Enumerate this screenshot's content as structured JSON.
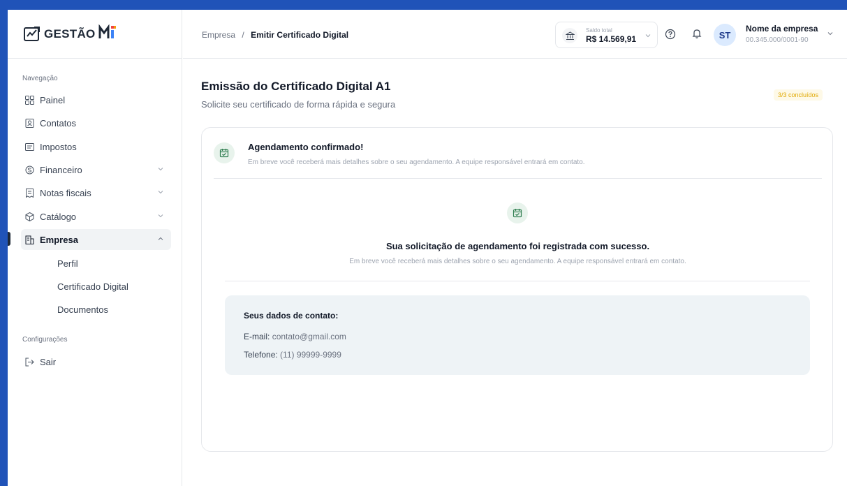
{
  "app": {
    "logo_text": "GESTÃO",
    "logo_mei": "MEI"
  },
  "sidebar": {
    "section_nav": "Navegação",
    "items": [
      {
        "label": "Painel",
        "icon": "grid-icon"
      },
      {
        "label": "Contatos",
        "icon": "contact-card-icon"
      },
      {
        "label": "Impostos",
        "icon": "tax-doc-icon"
      },
      {
        "label": "Financeiro",
        "icon": "money-icon"
      },
      {
        "label": "Notas fiscais",
        "icon": "receipt-icon"
      },
      {
        "label": "Catálogo",
        "icon": "box-icon"
      },
      {
        "label": "Empresa",
        "icon": "building-icon"
      }
    ],
    "empresa_sub": [
      "Perfil",
      "Certificado Digital",
      "Documentos"
    ],
    "section_config": "Configurações",
    "logout_label": "Sair"
  },
  "header": {
    "breadcrumb_parent": "Empresa",
    "breadcrumb_sep": "/",
    "breadcrumb_current": "Emitir Certificado Digital",
    "balance_label": "Saldo total",
    "balance_value": "R$ 14.569,91",
    "avatar_initials": "ST",
    "company_name": "Nome da empresa",
    "company_cnpj": "00.345.000/0001-90"
  },
  "page": {
    "title": "Emissão do Certificado Digital A1",
    "subtitle": "Solicite seu certificado de forma rápida e segura",
    "progress": "3/3 concluídos"
  },
  "card": {
    "confirm_title": "Agendamento confirmado!",
    "confirm_desc": "Em breve você receberá mais detalhes sobre o seu agendamento. A equipe responsável entrará em contato.",
    "success_title": "Sua solicitação de agendamento foi registrada com sucesso.",
    "success_desc": "Em breve você receberá mais detalhes sobre o seu agendamento. A equipe responsável entrará em contato.",
    "contact": {
      "title": "Seus dados de contato:",
      "email_label": "E-mail:",
      "email_value": "contato@gmail.com",
      "phone_label": "Telefone:",
      "phone_value": "(11) 99999-9999"
    }
  },
  "colors": {
    "accent_bar": "#2053b8",
    "success_green": "#2e7d4f",
    "badge_yellow": "#e0a800"
  }
}
